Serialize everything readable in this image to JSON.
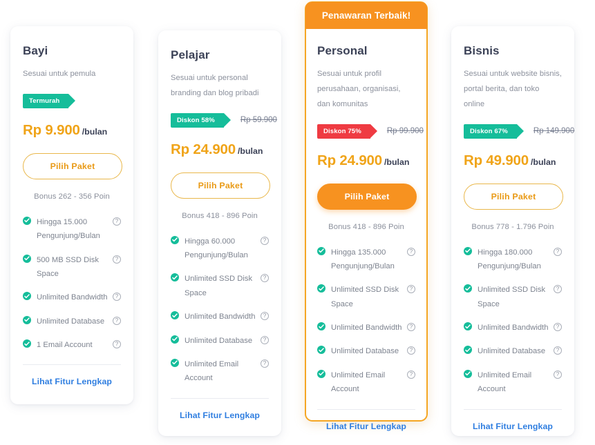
{
  "colors": {
    "teal": "#15bd9a",
    "red": "#ef3b42",
    "orange": "#f79220",
    "price_amber": "#f0a419",
    "link_blue": "#2f7ee0",
    "heading": "#3c4257",
    "muted": "#8b909c"
  },
  "plans": [
    {
      "name": "Bayi",
      "description": "Sesuai untuk pemula",
      "badge": {
        "label": "Termurah",
        "style": "teal"
      },
      "old_price": "",
      "price": "Rp 9.900",
      "period": "/bulan",
      "cta_label": "Pilih Paket",
      "cta_style": "outline",
      "bonus": "Bonus 262 - 356 Poin",
      "featured": false,
      "ribbon": "",
      "features": [
        "Hingga 15.000 Pengunjung/Bulan",
        "500 MB SSD Disk Space",
        "Unlimited Bandwidth",
        "Unlimited Database",
        "1 Email Account"
      ],
      "more_link": "Lihat Fitur Lengkap"
    },
    {
      "name": "Pelajar",
      "description": "Sesuai untuk personal branding dan blog pribadi",
      "badge": {
        "label": "Diskon 58%",
        "style": "teal"
      },
      "old_price": "Rp 59.900",
      "price": "Rp 24.900",
      "period": "/bulan",
      "cta_label": "Pilih Paket",
      "cta_style": "outline",
      "bonus": "Bonus 418 - 896 Poin",
      "featured": false,
      "ribbon": "",
      "features": [
        "Hingga 60.000 Pengunjung/Bulan",
        "Unlimited SSD Disk Space",
        "Unlimited Bandwidth",
        "Unlimited Database",
        "Unlimited Email Account"
      ],
      "more_link": "Lihat Fitur Lengkap"
    },
    {
      "name": "Personal",
      "description": "Sesuai untuk profil perusahaan, organisasi, dan komunitas",
      "badge": {
        "label": "Diskon 75%",
        "style": "red"
      },
      "old_price": "Rp 99.900",
      "price": "Rp 24.900",
      "period": "/bulan",
      "cta_label": "Pilih Paket",
      "cta_style": "solid",
      "bonus": "Bonus 418 - 896 Poin",
      "featured": true,
      "ribbon": "Penawaran Terbaik!",
      "features": [
        "Hingga 135.000 Pengunjung/Bulan",
        "Unlimited SSD Disk Space",
        "Unlimited Bandwidth",
        "Unlimited Database",
        "Unlimited Email Account"
      ],
      "more_link": "Lihat Fitur Lengkap"
    },
    {
      "name": "Bisnis",
      "description": "Sesuai untuk website bisnis, portal berita, dan toko online",
      "badge": {
        "label": "Diskon 67%",
        "style": "teal"
      },
      "old_price": "Rp 149.900",
      "price": "Rp 49.900",
      "period": "/bulan",
      "cta_label": "Pilih Paket",
      "cta_style": "outline",
      "bonus": "Bonus 778 - 1.796 Poin",
      "featured": false,
      "ribbon": "",
      "features": [
        "Hingga 180.000 Pengunjung/Bulan",
        "Unlimited SSD Disk Space",
        "Unlimited Bandwidth",
        "Unlimited Database",
        "Unlimited Email Account"
      ],
      "more_link": "Lihat Fitur Lengkap"
    }
  ],
  "icons": {
    "check": "check-icon",
    "help": "?"
  }
}
